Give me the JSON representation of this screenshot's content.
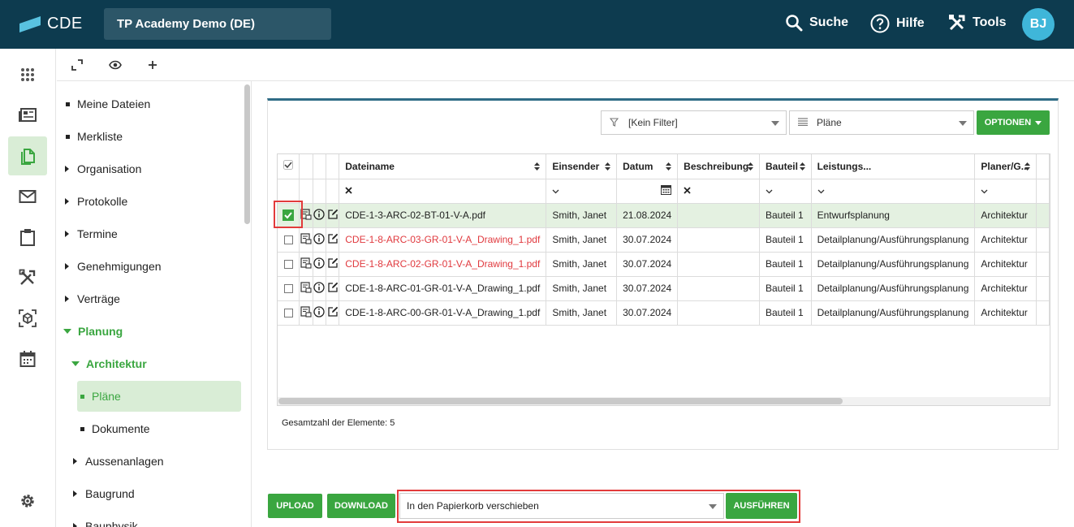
{
  "header": {
    "logo_text": "CDE",
    "project_name": "TP Academy Demo (DE)",
    "search_label": "Suche",
    "help_label": "Hilfe",
    "tools_label": "Tools",
    "avatar_initials": "BJ"
  },
  "rail": {
    "items": [
      {
        "name": "apps-icon"
      },
      {
        "name": "news-icon"
      },
      {
        "name": "documents-icon"
      },
      {
        "name": "mail-icon"
      },
      {
        "name": "clipboard-icon"
      },
      {
        "name": "tools-icon"
      },
      {
        "name": "model-icon"
      },
      {
        "name": "calendar-icon"
      },
      {
        "name": "settings-icon"
      }
    ]
  },
  "tree": {
    "items": [
      {
        "label": "Meine Dateien",
        "marker": "bullet"
      },
      {
        "label": "Merkliste",
        "marker": "bullet"
      },
      {
        "label": "Organisation",
        "marker": "caret"
      },
      {
        "label": "Protokolle",
        "marker": "caret"
      },
      {
        "label": "Termine",
        "marker": "caret"
      },
      {
        "label": "Genehmigungen",
        "marker": "caret"
      },
      {
        "label": "Verträge",
        "marker": "caret"
      },
      {
        "label": "Planung",
        "marker": "open"
      },
      {
        "label": "Architektur",
        "marker": "open"
      },
      {
        "label": "Pläne",
        "marker": "bullet",
        "selected": true
      },
      {
        "label": "Dokumente",
        "marker": "bullet"
      },
      {
        "label": "Aussenanlagen",
        "marker": "caret"
      },
      {
        "label": "Baugrund",
        "marker": "caret"
      },
      {
        "label": "Bauphysik",
        "marker": "caret"
      }
    ]
  },
  "toolbar": {
    "filter_value": "[Kein Filter]",
    "view_value": "Pläne",
    "options_label": "OPTIONEN"
  },
  "grid": {
    "columns": [
      "Dateiname",
      "Einsender",
      "Datum",
      "Beschreibung",
      "Bauteil",
      "Leistungs...",
      "Planer/G..."
    ],
    "rows": [
      {
        "checked": true,
        "file": "CDE-1-3-ARC-02-BT-01-V-A.pdf",
        "file_link": false,
        "sender": "Smith, Janet",
        "date": "21.08.2024",
        "description": "",
        "part": "Bauteil 1",
        "phase": "Entwurfsplanung",
        "planner": "Architektur"
      },
      {
        "checked": false,
        "file": "CDE-1-8-ARC-03-GR-01-V-A_Drawing_1.pdf",
        "file_link": true,
        "sender": "Smith, Janet",
        "date": "30.07.2024",
        "description": "",
        "part": "Bauteil 1",
        "phase": "Detailplanung/Ausführungsplanung",
        "planner": "Architektur"
      },
      {
        "checked": false,
        "file": "CDE-1-8-ARC-02-GR-01-V-A_Drawing_1.pdf",
        "file_link": true,
        "sender": "Smith, Janet",
        "date": "30.07.2024",
        "description": "",
        "part": "Bauteil 1",
        "phase": "Detailplanung/Ausführungsplanung",
        "planner": "Architektur"
      },
      {
        "checked": false,
        "file": "CDE-1-8-ARC-01-GR-01-V-A_Drawing_1.pdf",
        "file_link": false,
        "sender": "Smith, Janet",
        "date": "30.07.2024",
        "description": "",
        "part": "Bauteil 1",
        "phase": "Detailplanung/Ausführungsplanung",
        "planner": "Architektur"
      },
      {
        "checked": false,
        "file": "CDE-1-8-ARC-00-GR-01-V-A_Drawing_1.pdf",
        "file_link": false,
        "sender": "Smith, Janet",
        "date": "30.07.2024",
        "description": "",
        "part": "Bauteil 1",
        "phase": "Detailplanung/Ausführungsplanung",
        "planner": "Architektur"
      }
    ],
    "total_label": "Gesamtzahl der Elemente: 5"
  },
  "bottom": {
    "upload_label": "UPLOAD",
    "download_label": "DOWNLOAD",
    "action_value": "In den Papierkorb verschieben",
    "execute_label": "AUSFÜHREN"
  },
  "colors": {
    "header_bg": "#0d3b4f",
    "accent_green": "#3aa640",
    "link_red": "#e0393e",
    "highlight_red": "#e23b3b"
  }
}
